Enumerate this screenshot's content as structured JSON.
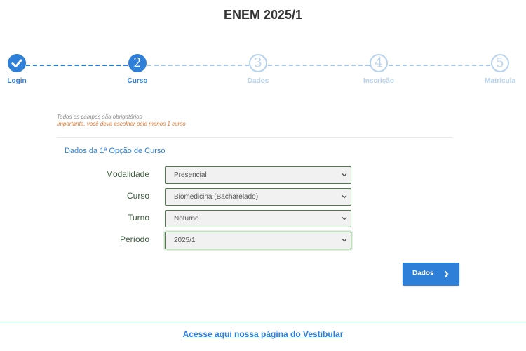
{
  "header": {
    "title": "ENEM 2025/1"
  },
  "stepper": {
    "steps": [
      {
        "number": "",
        "label": "Login",
        "state": "completed",
        "icon": "check-icon"
      },
      {
        "number": "2",
        "label": "Curso",
        "state": "active"
      },
      {
        "number": "3",
        "label": "Dados",
        "state": "pending"
      },
      {
        "number": "4",
        "label": "Inscrição",
        "state": "pending"
      },
      {
        "number": "5",
        "label": "Matrícula",
        "state": "pending"
      }
    ]
  },
  "notes": {
    "required": "Todos os campos são obrigatórios",
    "important": "Importante, você deve escolher pelo menos 1 curso"
  },
  "form": {
    "section_title": "Dados da 1ª Opção de Curso",
    "fields": [
      {
        "label": "Modalidade",
        "value": "Presencial"
      },
      {
        "label": "Curso",
        "value": "Biomedicina (Bacharelado)"
      },
      {
        "label": "Turno",
        "value": "Noturno"
      },
      {
        "label": "Período",
        "value": "2025/1"
      }
    ]
  },
  "actions": {
    "next_label": "Dados",
    "next_icon": "chevron-right-icon"
  },
  "footer": {
    "link_text": "Acesse aqui nossa página do Vestibular"
  },
  "colors": {
    "primary": "#2e7fd8",
    "pending": "#b7d2ef",
    "warning": "#e5742c",
    "field_border": "#4e7a4e"
  }
}
